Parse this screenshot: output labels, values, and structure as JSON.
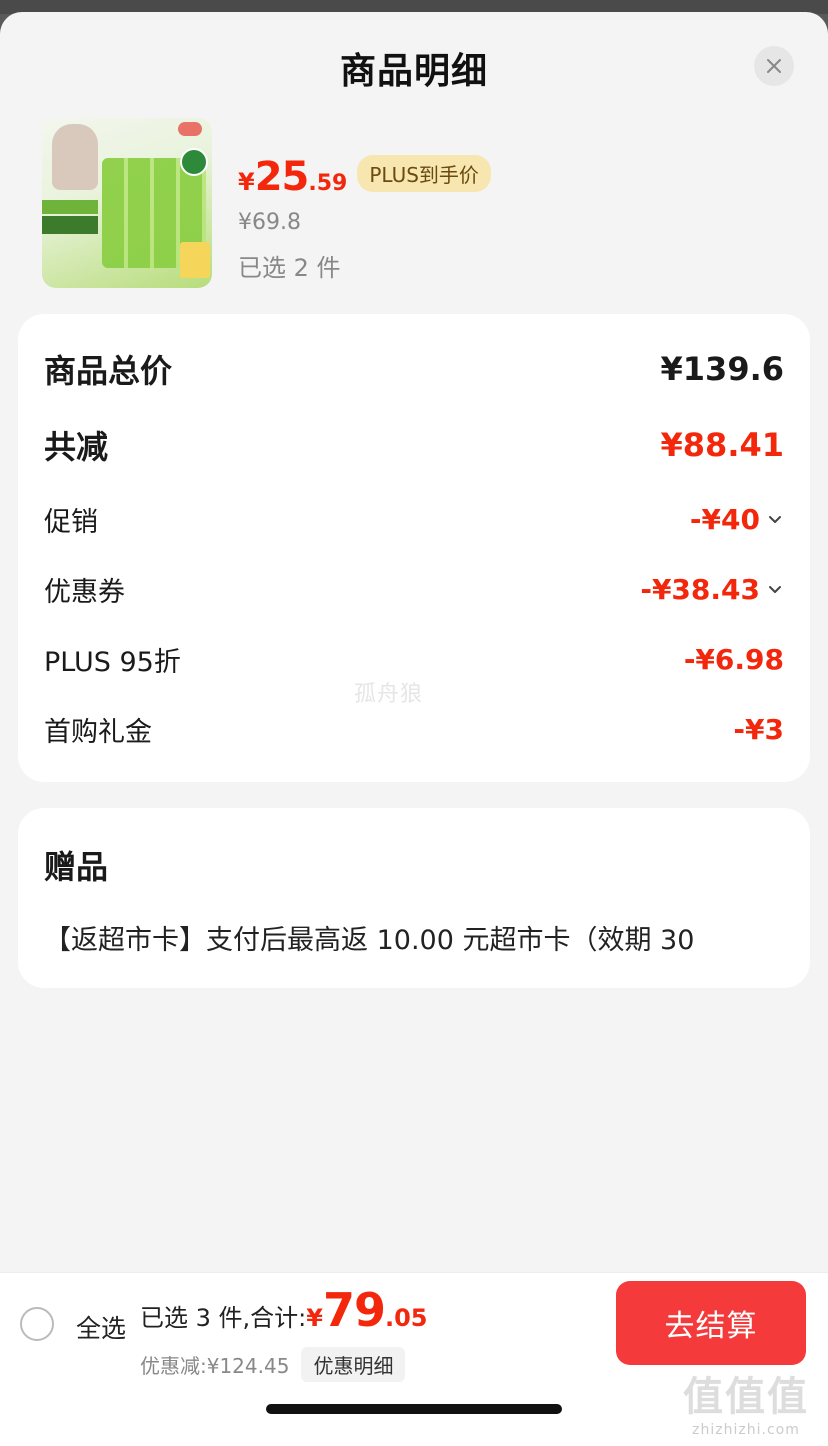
{
  "sheet": {
    "title": "商品明细"
  },
  "product": {
    "price_symbol": "¥",
    "price_int": "25",
    "price_dec": ".59",
    "plus_tag": "PLUS到手价",
    "original_price": "¥69.8",
    "selected_count": "已选 2 件"
  },
  "price_details": {
    "rows": [
      {
        "label": "商品总价",
        "value": "¥139.6"
      },
      {
        "label": "共减",
        "value": "¥88.41"
      },
      {
        "label": "促销",
        "value": "-¥40"
      },
      {
        "label": "优惠券",
        "value": "-¥38.43"
      },
      {
        "label": "PLUS 95折",
        "value": "-¥6.98"
      },
      {
        "label": "首购礼金",
        "value": "-¥3"
      }
    ],
    "watermark": "孤舟狼"
  },
  "gift": {
    "title": "赠品",
    "text": "【返超市卡】支付后最高返 10.00 元超市卡（效期 30"
  },
  "bottom_bar": {
    "select_all": "全选",
    "summary_text": "已选 3 件,合计:",
    "total_symbol": "¥",
    "total_int": "79",
    "total_dec": ".05",
    "discount_text": "优惠减:¥124.45",
    "discount_detail_button": "优惠明细",
    "checkout_button": "去结算"
  },
  "site_watermark": {
    "mark": "值值值",
    "domain": "zhizhizhi.com"
  },
  "colors": {
    "accent_red": "#f2270c",
    "checkout_red": "#f43a3a",
    "plus_gold": "#f7e6b0"
  },
  "icons": {
    "close": "close-icon",
    "expand": "chevron-down-icon"
  }
}
